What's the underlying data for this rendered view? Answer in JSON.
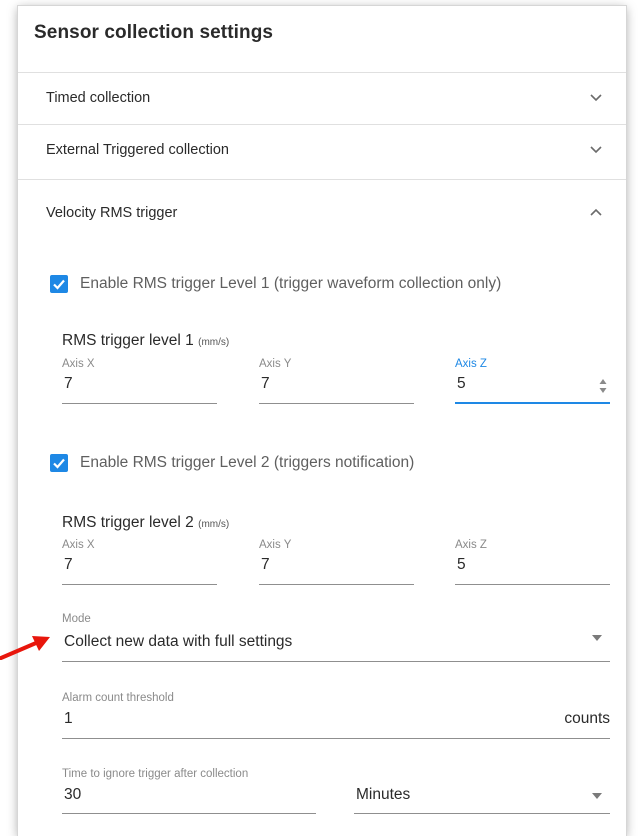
{
  "panel": {
    "title": "Sensor collection settings"
  },
  "accordions": {
    "timed": {
      "label": "Timed collection"
    },
    "external": {
      "label": "External Triggered collection"
    },
    "velocity": {
      "label": "Velocity RMS trigger"
    }
  },
  "level1": {
    "checkbox_label": "Enable RMS trigger Level 1 (trigger waveform collection only)",
    "checked": true,
    "title": "RMS trigger level 1",
    "unit": "(mm/s)",
    "axis_x": {
      "label": "Axis X",
      "value": "7"
    },
    "axis_y": {
      "label": "Axis Y",
      "value": "7"
    },
    "axis_z": {
      "label": "Axis Z",
      "value": "5"
    }
  },
  "level2": {
    "checkbox_label": "Enable RMS trigger Level 2 (triggers notification)",
    "checked": true,
    "title": "RMS trigger level 2",
    "unit": "(mm/s)",
    "axis_x": {
      "label": "Axis X",
      "value": "7"
    },
    "axis_y": {
      "label": "Axis Y",
      "value": "7"
    },
    "axis_z": {
      "label": "Axis Z",
      "value": "5"
    }
  },
  "mode": {
    "label": "Mode",
    "value": "Collect new data with full settings"
  },
  "alarm": {
    "label": "Alarm count threshold",
    "value": "1",
    "suffix": "counts"
  },
  "ignore": {
    "label": "Time to ignore trigger after collection",
    "value": "30",
    "unit_value": "Minutes"
  },
  "colors": {
    "accent": "#1e88e5",
    "annotation_arrow": "#e8160c"
  },
  "icons": [
    "chevron-down-icon",
    "chevron-up-icon",
    "checkmark-icon",
    "spinner-icon",
    "dropdown-arrow-icon",
    "annotation-arrow"
  ]
}
